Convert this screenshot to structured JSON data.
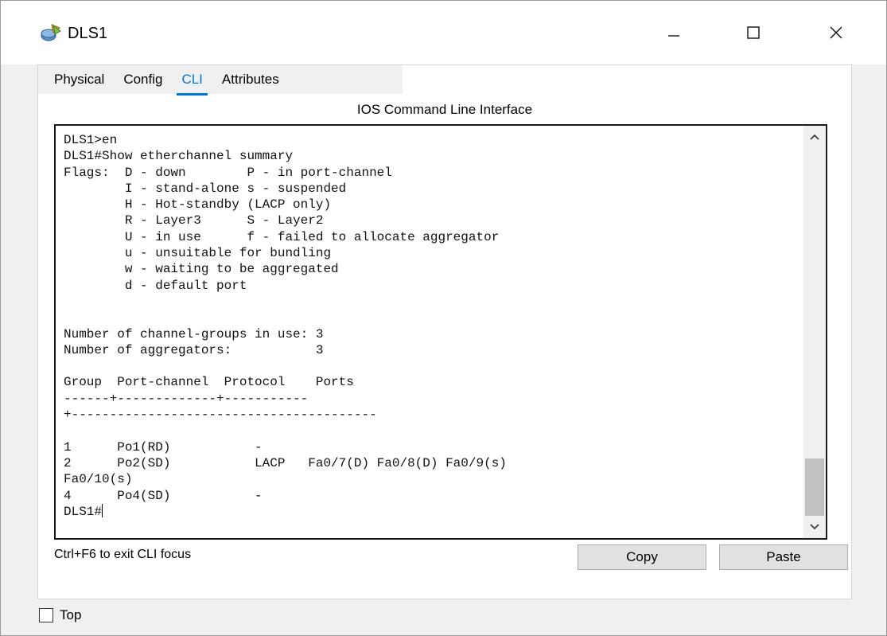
{
  "window": {
    "title": "DLS1",
    "icon": "router-device-icon"
  },
  "tabs": [
    {
      "label": "Physical",
      "active": false
    },
    {
      "label": "Config",
      "active": false
    },
    {
      "label": "CLI",
      "active": true
    },
    {
      "label": "Attributes",
      "active": false
    }
  ],
  "cli": {
    "header": "IOS Command Line Interface",
    "lines": [
      "DLS1>en",
      "DLS1#Show etherchannel summary",
      "Flags:  D - down        P - in port-channel",
      "        I - stand-alone s - suspended",
      "        H - Hot-standby (LACP only)",
      "        R - Layer3      S - Layer2",
      "        U - in use      f - failed to allocate aggregator",
      "        u - unsuitable for bundling",
      "        w - waiting to be aggregated",
      "        d - default port",
      "",
      "",
      "Number of channel-groups in use: 3",
      "Number of aggregators:           3",
      "",
      "Group  Port-channel  Protocol    Ports",
      "------+-------------+-----------",
      "+----------------------------------------",
      "",
      "1      Po1(RD)           -",
      "2      Po2(SD)           LACP   Fa0/7(D) Fa0/8(D) Fa0/9(s)",
      "Fa0/10(s)",
      "4      Po4(SD)           -"
    ],
    "prompt": "DLS1#"
  },
  "footer": {
    "exit_hint": "Ctrl+F6 to exit CLI focus",
    "copy_label": "Copy",
    "paste_label": "Paste"
  },
  "bottom": {
    "top_label": "Top",
    "top_checked": false
  },
  "colors": {
    "accent": "#0078d7",
    "terminal_border": "#1a1a1a",
    "button_bg": "#e1e1e1"
  }
}
